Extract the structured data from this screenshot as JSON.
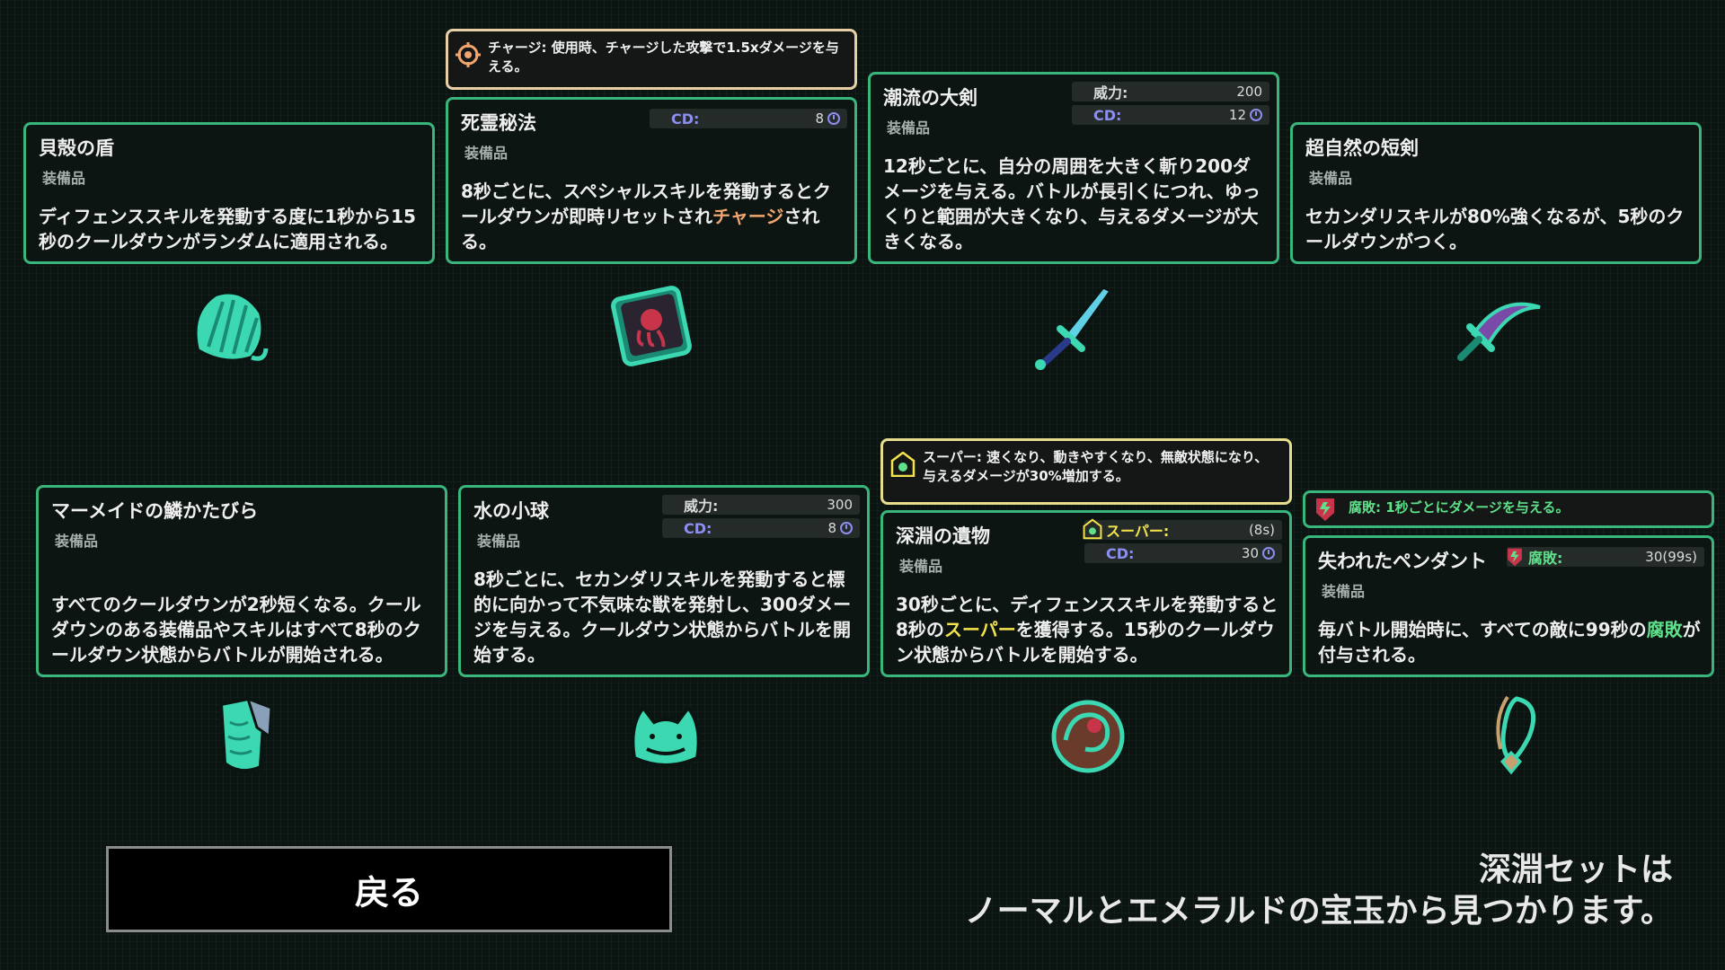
{
  "tooltips": {
    "charge": "チャージ: 使用時、チャージした攻撃で1.5xダメージを与える。",
    "super": "スーパー: 速くなり、動きやすくなり、無敵状態になり、与えるダメージが30%増加する。",
    "rot": "腐敗: 1秒ごとにダメージを与える。"
  },
  "items": {
    "shell_shield": {
      "name": "貝殻の盾",
      "type": "装備品",
      "desc": "ディフェンススキルを発動する度に1秒から15秒のクールダウンがランダムに適用される。",
      "icon": "shell-shield-icon"
    },
    "necronomicon": {
      "name": "死霊秘法",
      "type": "装備品",
      "cd_label": "CD:",
      "cd_value": "8",
      "desc_a": "8秒ごとに、スペシャルスキルを発動するとクールダウンが即時リセットされ",
      "desc_hl": "チャージ",
      "desc_b": "される。",
      "icon": "necronomicon-icon"
    },
    "tidal_sword": {
      "name": "潮流の大剣",
      "type": "装備品",
      "power_label": "威力:",
      "power_value": "200",
      "cd_label": "CD:",
      "cd_value": "12",
      "desc": "12秒ごとに、自分の周囲を大きく斬り200ダメージを与える。バトルが長引くにつれ、ゆっくりと範囲が大きくなり、与えるダメージが大きくなる。",
      "icon": "tidal-sword-icon"
    },
    "supernatural_dagger": {
      "name": "超自然の短剣",
      "type": "装備品",
      "desc": "セカンダリスキルが80%強くなるが、5秒のクールダウンがつく。",
      "icon": "supernatural-dagger-icon"
    },
    "mermaid_scale": {
      "name": "マーメイドの鱗かたびら",
      "type": "装備品",
      "desc": "すべてのクールダウンが2秒短くなる。クールダウンのある装備品やスキルはすべて8秒のクールダウン状態からバトルが開始される。",
      "icon": "mermaid-scale-icon"
    },
    "water_orb": {
      "name": "水の小球",
      "type": "装備品",
      "power_label": "威力:",
      "power_value": "300",
      "cd_label": "CD:",
      "cd_value": "8",
      "desc": "8秒ごとに、セカンダリスキルを発動すると標的に向かって不気味な獣を発射し、300ダメージを与える。クールダウン状態からバトルを開始する。",
      "icon": "water-orb-icon"
    },
    "abyss_relic": {
      "name": "深淵の遺物",
      "type": "装備品",
      "super_label": "スーパー:",
      "super_value": "(8s)",
      "cd_label": "CD:",
      "cd_value": "30",
      "desc_a": "30秒ごとに、ディフェンススキルを発動すると8秒の",
      "desc_hl": "スーパー",
      "desc_b": "を獲得する。15秒のクールダウン状態からバトルを開始する。",
      "icon": "abyss-relic-icon"
    },
    "lost_pendant": {
      "name": "失われたペンダント",
      "type": "装備品",
      "rot_label": "腐敗:",
      "rot_value": "30(99s)",
      "desc_a": "毎バトル開始時に、すべての敵に99秒の",
      "desc_hl": "腐敗",
      "desc_b": "が付与される。",
      "icon": "lost-pendant-icon"
    }
  },
  "back_button": "戻る",
  "footer": {
    "line1": "深淵セットは",
    "line2": "ノーマルとエメラルドの宝玉から見つかります。"
  },
  "colors": {
    "card_border": "#38b67c",
    "charge": "#f0a66e",
    "super": "#f3e34c",
    "rot": "#5fe08a",
    "cd": "#8d8ff0"
  }
}
